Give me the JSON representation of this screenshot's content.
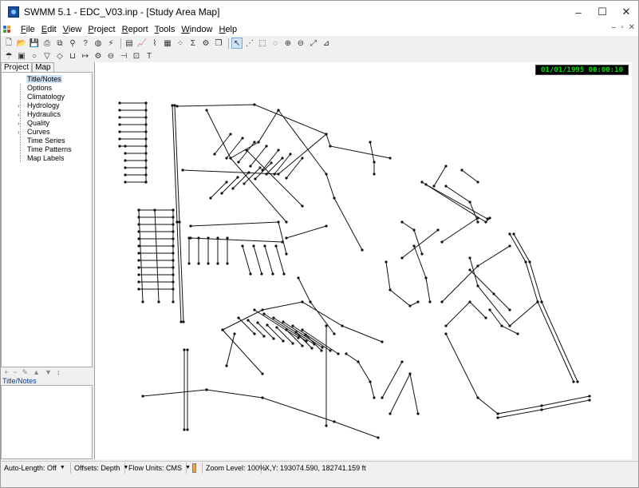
{
  "window": {
    "title": "SWMM 5.1 - EDC_V03.inp - [Study Area Map]",
    "controls": {
      "minimize": "–",
      "maximize": "☐",
      "close": "✕"
    }
  },
  "menu": {
    "items": [
      {
        "accel": "F",
        "rest": "ile"
      },
      {
        "accel": "E",
        "rest": "dit"
      },
      {
        "accel": "V",
        "rest": "iew"
      },
      {
        "accel": "P",
        "rest": "roject"
      },
      {
        "accel": "R",
        "rest": "eport"
      },
      {
        "accel": "T",
        "rest": "ools"
      },
      {
        "accel": "W",
        "rest": "indow"
      },
      {
        "accel": "H",
        "rest": "elp"
      }
    ],
    "mdi_controls": {
      "minimize": "–",
      "restore": "▫",
      "close": "✕"
    }
  },
  "toolbar1": [
    "new-file-icon",
    "open-file-icon",
    "save-icon",
    "print-icon",
    "copy-icon",
    "find-icon",
    "query-icon",
    "globe-icon",
    "run-icon",
    "summary-icon",
    "graph-icon",
    "profile-icon",
    "table-icon",
    "scatter-icon",
    "statistics-icon",
    "options-icon",
    "window-icon",
    "select-pointer-icon",
    "select-vertex-icon",
    "select-region-icon",
    "select-all-icon",
    "zoom-in-icon",
    "zoom-out-icon",
    "full-extent-icon",
    "measure-icon"
  ],
  "toolbar2": [
    "raingage-icon",
    "subcatchment-icon",
    "junction-icon",
    "outfall-icon",
    "divider-icon",
    "storage-icon",
    "conduit-icon",
    "pump-icon",
    "orifice-icon",
    "weir-icon",
    "outlet-icon",
    "label-icon"
  ],
  "left_panel": {
    "tabs": [
      "Project",
      "Map"
    ],
    "tree": [
      {
        "label": "Title/Notes",
        "expandable": false
      },
      {
        "label": "Options",
        "expandable": false
      },
      {
        "label": "Climatology",
        "expandable": false
      },
      {
        "label": "Hydrology",
        "expandable": true
      },
      {
        "label": "Hydraulics",
        "expandable": true
      },
      {
        "label": "Quality",
        "expandable": true
      },
      {
        "label": "Curves",
        "expandable": true
      },
      {
        "label": "Time Series",
        "expandable": false
      },
      {
        "label": "Time Patterns",
        "expandable": false
      },
      {
        "label": "Map Labels",
        "expandable": false
      }
    ],
    "object_buttons": [
      "+",
      "−",
      "✎",
      "▲",
      "▼",
      "↕"
    ],
    "notes_label": "Title/Notes"
  },
  "map": {
    "clock": "01/01/1995 00:00:10"
  },
  "statusbar": {
    "auto_length": "Auto-Length: Off",
    "offsets": "Offsets: Depth",
    "flow_units": "Flow Units: CMS",
    "zoom": "Zoom Level: 100%",
    "coords": "X,Y: 193074.590, 182741.159 ft"
  }
}
